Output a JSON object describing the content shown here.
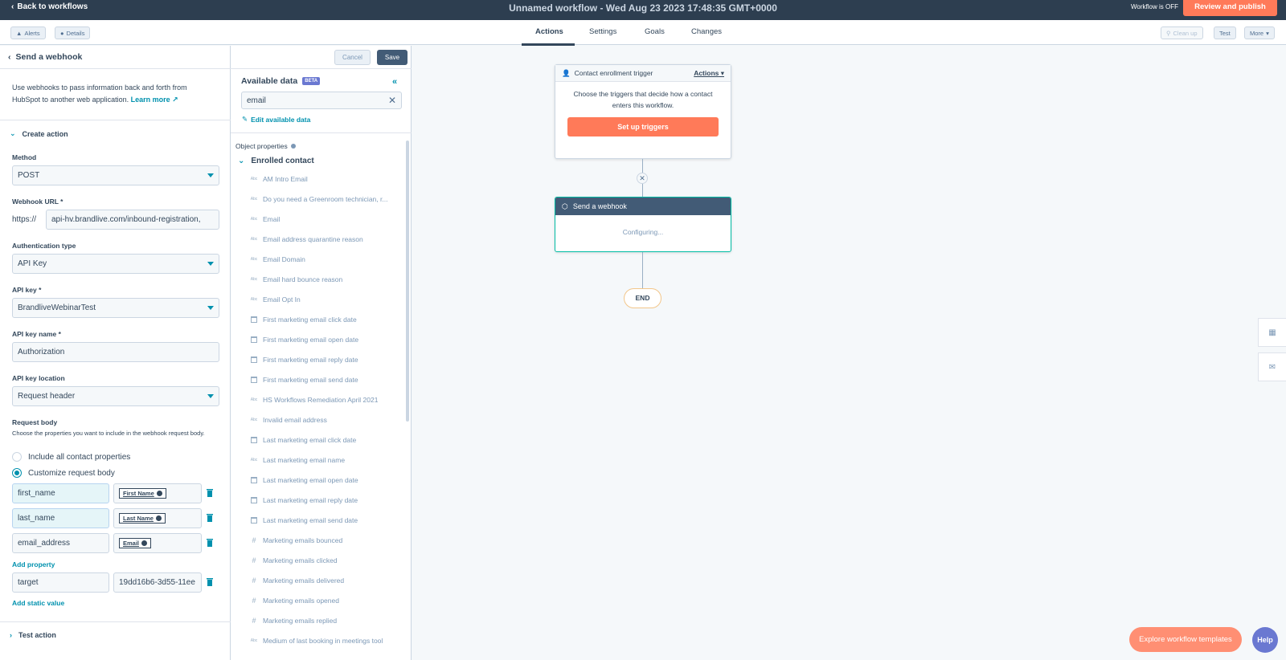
{
  "topbar": {
    "back_label": "Back to workflows",
    "title": "Unnamed workflow - Wed Aug 23 2023 17:48:35 GMT+0000",
    "status": "Workflow is OFF",
    "review_label": "Review and publish"
  },
  "toolbar": {
    "alerts_label": "Alerts",
    "details_label": "Details",
    "tabs": [
      "Actions",
      "Settings",
      "Goals",
      "Changes"
    ],
    "cleanup_label": "Clean up",
    "test_label": "Test",
    "more_label": "More"
  },
  "panel": {
    "title": "Send a webhook",
    "cancel_label": "Cancel",
    "save_label": "Save",
    "description": "Use webhooks to pass information back and forth from HubSpot to another web application.",
    "learn_more": "Learn more",
    "create_action_label": "Create action",
    "method_label": "Method",
    "method_value": "POST",
    "webhook_url_label": "Webhook URL *",
    "url_prefix": "https://",
    "url_value": "api-hv.brandlive.com/inbound-registration,",
    "auth_type_label": "Authentication type",
    "auth_type_value": "API Key",
    "api_key_label": "API key *",
    "api_key_value": "BrandliveWebinarTest",
    "api_key_name_label": "API key name *",
    "api_key_name_value": "Authorization",
    "api_key_location_label": "API key location",
    "api_key_location_value": "Request header",
    "request_body_label": "Request body",
    "request_body_note": "Choose the properties you want to include in the webhook request body.",
    "radio_all": "Include all contact properties",
    "radio_custom": "Customize request body",
    "body_rows": [
      {
        "key": "first_name",
        "token": "First Name"
      },
      {
        "key": "last_name",
        "token": "Last Name"
      },
      {
        "key": "email_address",
        "token": "Email"
      }
    ],
    "add_property": "Add property",
    "static_key": "target",
    "static_value": "19dd16b6-3d55-11ee",
    "add_static": "Add static value",
    "test_action_label": "Test action"
  },
  "available_data": {
    "title": "Available data",
    "beta": "BETA",
    "search_value": "email",
    "edit_link": "Edit available data",
    "object_properties": "Object properties",
    "enrolled_contact": "Enrolled contact",
    "properties": [
      {
        "label": "AM Intro Email",
        "type": "abc"
      },
      {
        "label": "Do you need a Greenroom technician, r...",
        "type": "abc"
      },
      {
        "label": "Email",
        "type": "abc"
      },
      {
        "label": "Email address quarantine reason",
        "type": "abc"
      },
      {
        "label": "Email Domain",
        "type": "abc"
      },
      {
        "label": "Email hard bounce reason",
        "type": "abc"
      },
      {
        "label": "Email Opt In",
        "type": "abc"
      },
      {
        "label": "First marketing email click date",
        "type": "date"
      },
      {
        "label": "First marketing email open date",
        "type": "date"
      },
      {
        "label": "First marketing email reply date",
        "type": "date"
      },
      {
        "label": "First marketing email send date",
        "type": "date"
      },
      {
        "label": "HS Workflows Remediation April 2021",
        "type": "abc"
      },
      {
        "label": "Invalid email address",
        "type": "abc"
      },
      {
        "label": "Last marketing email click date",
        "type": "date"
      },
      {
        "label": "Last marketing email name",
        "type": "abc"
      },
      {
        "label": "Last marketing email open date",
        "type": "date"
      },
      {
        "label": "Last marketing email reply date",
        "type": "date"
      },
      {
        "label": "Last marketing email send date",
        "type": "date"
      },
      {
        "label": "Marketing emails bounced",
        "type": "number"
      },
      {
        "label": "Marketing emails clicked",
        "type": "number"
      },
      {
        "label": "Marketing emails delivered",
        "type": "number"
      },
      {
        "label": "Marketing emails opened",
        "type": "number"
      },
      {
        "label": "Marketing emails replied",
        "type": "number"
      },
      {
        "label": "Medium of last booking in meetings tool",
        "type": "abc"
      }
    ]
  },
  "canvas": {
    "trigger_title": "Contact enrollment trigger",
    "trigger_actions": "Actions",
    "trigger_body": "Choose the triggers that decide how a contact enters this workflow.",
    "setup_label": "Set up triggers",
    "webhook_title": "Send a webhook",
    "webhook_status": "Configuring...",
    "end_label": "END",
    "explore_label": "Explore workflow templates",
    "help_label": "Help"
  },
  "colors": {
    "accent": "#0091ae",
    "brand_orange": "#ff7a59",
    "header_dark": "#2d3e50"
  }
}
